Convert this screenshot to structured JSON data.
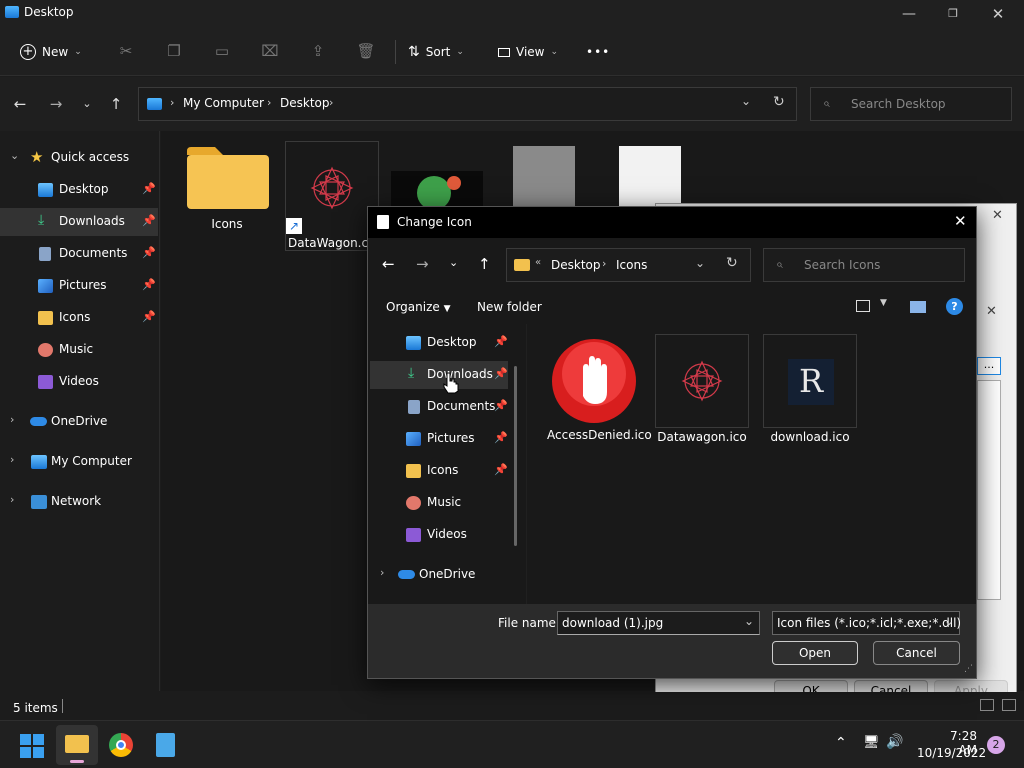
{
  "window": {
    "title": "Desktop"
  },
  "toolbar": {
    "new_label": "New",
    "sort_label": "Sort",
    "view_label": "View",
    "more_label": "•••"
  },
  "address": {
    "path": [
      "My Computer",
      "Desktop"
    ],
    "search_placeholder": "Search Desktop"
  },
  "sidebar": {
    "quick_access": "Quick access",
    "items": [
      {
        "label": "Desktop",
        "icon": "desktop-icon"
      },
      {
        "label": "Downloads",
        "icon": "download-icon"
      },
      {
        "label": "Documents",
        "icon": "document-icon"
      },
      {
        "label": "Pictures",
        "icon": "pictures-icon"
      },
      {
        "label": "Icons",
        "icon": "folder-icon"
      },
      {
        "label": "Music",
        "icon": "music-icon"
      },
      {
        "label": "Videos",
        "icon": "video-icon"
      }
    ],
    "onedrive": "OneDrive",
    "mycomputer": "My Computer",
    "network": "Network"
  },
  "content": {
    "files": [
      {
        "name": "Icons",
        "type": "folder"
      },
      {
        "name": "DataWagon.com",
        "type": "shortcut"
      }
    ]
  },
  "status": {
    "items": "5 items"
  },
  "taskbar": {
    "time": "7:28 AM",
    "date": "10/19/2022",
    "notifications": "2"
  },
  "props": {
    "ok": "OK",
    "cancel": "Cancel",
    "apply": "Apply",
    "browse": "..."
  },
  "dialog": {
    "title": "Change Icon",
    "path": [
      "Desktop",
      "Icons"
    ],
    "search_placeholder": "Search Icons",
    "organize": "Organize",
    "new_folder": "New folder",
    "side": [
      {
        "label": "Desktop"
      },
      {
        "label": "Downloads"
      },
      {
        "label": "Documents"
      },
      {
        "label": "Pictures"
      },
      {
        "label": "Icons"
      },
      {
        "label": "Music"
      },
      {
        "label": "Videos"
      }
    ],
    "onedrive": "OneDrive",
    "files": [
      {
        "name": "AccessDenied.ico"
      },
      {
        "name": "Datawagon.ico"
      },
      {
        "name": "download.ico"
      }
    ],
    "filename_label": "File name:",
    "filename_value": "download (1).jpg",
    "filetype_value": "Icon files (*.ico;*.icl;*.exe;*.dll)",
    "open": "Open",
    "cancel": "Cancel"
  }
}
